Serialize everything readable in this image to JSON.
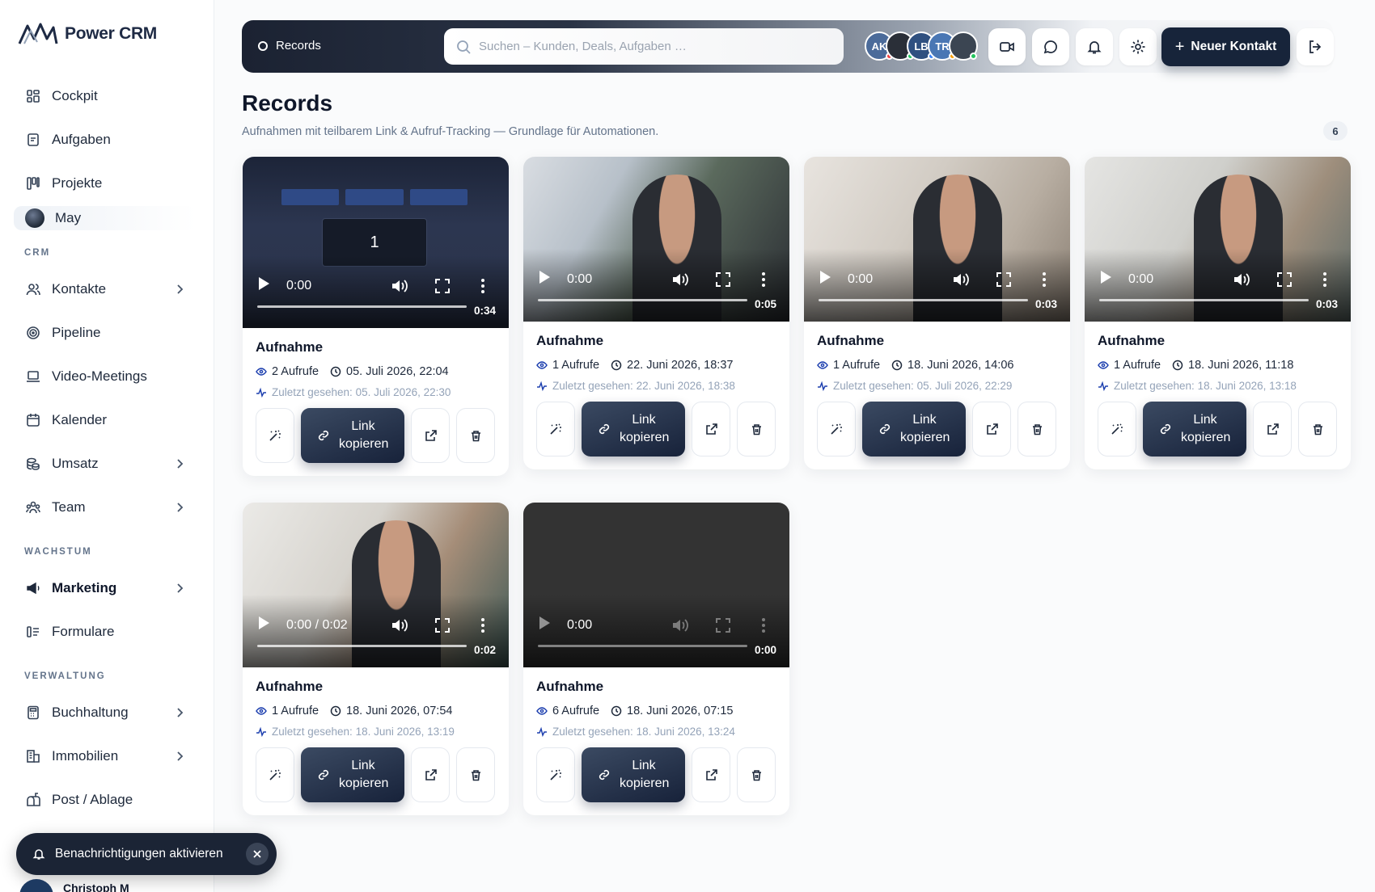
{
  "app": {
    "name_part1": "Power",
    "name_part2": "CRM"
  },
  "sidebar": {
    "items_top": [
      {
        "label": "Cockpit",
        "icon": "dashboard-icon"
      },
      {
        "label": "Aufgaben",
        "icon": "clipboard-icon"
      },
      {
        "label": "Projekte",
        "icon": "kanban-icon"
      }
    ],
    "project_sub": {
      "label": "May"
    },
    "section_crm": "CRM",
    "items_crm": [
      {
        "label": "Kontakte",
        "icon": "users-icon",
        "chevron": true
      },
      {
        "label": "Pipeline",
        "icon": "target-icon",
        "chevron": false
      },
      {
        "label": "Video-Meetings",
        "icon": "laptop-icon",
        "chevron": false
      },
      {
        "label": "Kalender",
        "icon": "calendar-icon",
        "chevron": false
      },
      {
        "label": "Umsatz",
        "icon": "coins-icon",
        "chevron": true
      },
      {
        "label": "Team",
        "icon": "team-icon",
        "chevron": true
      }
    ],
    "section_growth": "WACHSTUM",
    "items_growth": [
      {
        "label": "Marketing",
        "icon": "megaphone-icon",
        "chevron": true
      },
      {
        "label": "Formulare",
        "icon": "form-icon",
        "chevron": false
      }
    ],
    "section_admin": "VERWALTUNG",
    "items_admin": [
      {
        "label": "Buchhaltung",
        "icon": "calculator-icon",
        "chevron": true
      },
      {
        "label": "Immobilien",
        "icon": "building-icon",
        "chevron": true
      },
      {
        "label": "Post / Ablage",
        "icon": "mailbox-icon",
        "chevron": false
      }
    ],
    "notification": {
      "label": "Benachrichtigungen aktivieren"
    },
    "user": {
      "name": "Christoph M"
    }
  },
  "topbar": {
    "breadcrumb": "Records",
    "search_placeholder": "Suchen – Kunden, Deals, Aufgaben …",
    "avatars": [
      {
        "initials": "AK",
        "color": "#4b6b9a",
        "status": "#ef4444"
      },
      {
        "initials": "",
        "color": "#2a2f38",
        "status": "#22c55e"
      },
      {
        "initials": "LB",
        "color": "#2f5080",
        "status": "#3b82f6"
      },
      {
        "initials": "TR",
        "color": "#4a77b4",
        "status": "#f59e0b"
      },
      {
        "initials": "",
        "color": "#3b4552",
        "status": "#22c55e"
      }
    ],
    "new_contact_label": "Neuer Kontakt"
  },
  "page": {
    "title": "Records",
    "subtitle": "Aufnahmen mit teilbarem Link & Aufruf-Tracking — Grundlage für Automationen.",
    "count": "6"
  },
  "colors": {
    "accent": "#17243a",
    "muted": "#64748b"
  },
  "recordings": [
    {
      "title": "Aufnahme",
      "views": "2 Aufrufe",
      "date": "05. Juli 2026, 22:04",
      "last_seen": "Zuletzt gesehen: 05. Juli 2026, 22:30",
      "time": "0:00",
      "duration": "0:34",
      "copy_label": "Link kopieren"
    },
    {
      "title": "Aufnahme",
      "views": "1 Aufrufe",
      "date": "22. Juni 2026, 18:37",
      "last_seen": "Zuletzt gesehen: 22. Juni 2026, 18:38",
      "time": "0:00",
      "duration": "0:05",
      "copy_label": "Link kopieren"
    },
    {
      "title": "Aufnahme",
      "views": "1 Aufrufe",
      "date": "18. Juni 2026, 14:06",
      "last_seen": "Zuletzt gesehen: 05. Juli 2026, 22:29",
      "time": "0:00",
      "duration": "0:03",
      "copy_label": "Link kopieren"
    },
    {
      "title": "Aufnahme",
      "views": "1 Aufrufe",
      "date": "18. Juni 2026, 11:18",
      "last_seen": "Zuletzt gesehen: 18. Juni 2026, 13:18",
      "time": "0:00",
      "duration": "0:03",
      "copy_label": "Link kopieren"
    },
    {
      "title": "Aufnahme",
      "views": "1 Aufrufe",
      "date": "18. Juni 2026, 07:54",
      "last_seen": "Zuletzt gesehen: 18. Juni 2026, 13:19",
      "time": "0:00 / 0:02",
      "duration": "0:02",
      "copy_label": "Link kopieren"
    },
    {
      "title": "Aufnahme",
      "views": "6 Aufrufe",
      "date": "18. Juni 2026, 07:15",
      "last_seen": "Zuletzt gesehen: 18. Juni 2026, 13:24",
      "time": "0:00",
      "duration": "0:00",
      "copy_label": "Link kopieren"
    }
  ],
  "video_overlay_text": "1"
}
